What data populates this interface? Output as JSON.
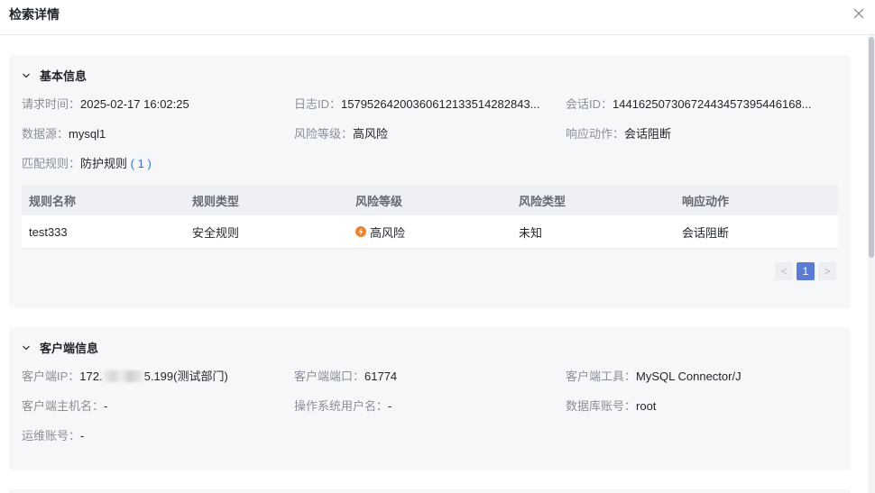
{
  "drawer": {
    "title": "检索详情"
  },
  "basic": {
    "title": "基本信息",
    "fields": [
      {
        "label": "请求时间：",
        "value": "2025-02-17 16:02:25"
      },
      {
        "label": "日志ID：",
        "value": "15795264200360612133514282843..."
      },
      {
        "label": "会话ID：",
        "value": "14416250730672443457395446168..."
      },
      {
        "label": "数据源：",
        "value": "mysql1"
      },
      {
        "label": "风险等级：",
        "value": "高风险"
      },
      {
        "label": "响应动作：",
        "value": "会话阻断"
      },
      {
        "label": "匹配规则：",
        "value": "防护规则",
        "count": "( 1 )"
      }
    ],
    "table": {
      "headers": [
        "规则名称",
        "规则类型",
        "风险等级",
        "风险类型",
        "响应动作"
      ],
      "rows": [
        [
          "test333",
          "安全规则",
          "高风险",
          "未知",
          "会话阻断"
        ]
      ]
    },
    "pagination": {
      "prev": "<",
      "current": "1",
      "next": ">"
    }
  },
  "client": {
    "title": "客户端信息",
    "fields": [
      {
        "label": "客户端IP：",
        "value_prefix": "172.",
        "value_suffix": "5.199(测试部门)"
      },
      {
        "label": "客户端端口：",
        "value": "61774"
      },
      {
        "label": "客户端工具：",
        "value": "MySQL Connector/J"
      },
      {
        "label": "客户端主机名：",
        "value": "-"
      },
      {
        "label": "操作系统用户名：",
        "value": "-"
      },
      {
        "label": "数据库账号：",
        "value": "root"
      },
      {
        "label": "运维账号：",
        "value": "-"
      }
    ]
  },
  "colors": {
    "accent": "#5b7bd5",
    "link": "#3b6fe0",
    "risk_high": "#e9852f"
  },
  "icons": {
    "close": "close-icon",
    "collapse": "chevron-down-icon",
    "risk": "high-risk-icon"
  }
}
